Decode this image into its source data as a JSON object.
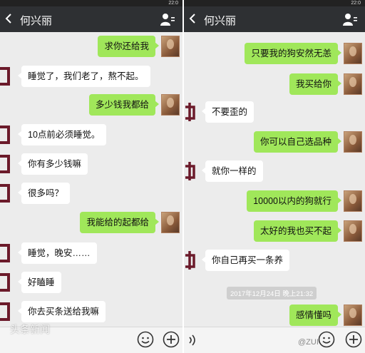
{
  "status_text": "22:0",
  "left": {
    "title": "何兴丽",
    "messages": [
      {
        "side": "me",
        "text": "求你还给我"
      },
      {
        "side": "them",
        "text": "睡觉了，我们老了，熬不起。"
      },
      {
        "side": "me",
        "text": "多少钱我都给"
      },
      {
        "side": "them",
        "text": "10点前必须睡觉。"
      },
      {
        "side": "them",
        "text": "你有多少钱嘛"
      },
      {
        "side": "them",
        "text": "很多吗？"
      },
      {
        "side": "me",
        "text": "我能给的起都给"
      },
      {
        "side": "them",
        "text": "睡觉，晚安……"
      },
      {
        "side": "them",
        "text": "好瞌睡"
      },
      {
        "side": "them",
        "text": "你去买条送给我嘛"
      }
    ],
    "watermark": "头条新闻"
  },
  "right": {
    "title": "何兴丽",
    "messages": [
      {
        "side": "me",
        "text": "只要我的狗安然无恙"
      },
      {
        "side": "me",
        "text": "我买给你"
      },
      {
        "side": "them",
        "text": "不要歪的"
      },
      {
        "side": "me",
        "text": "你可以自己选品种"
      },
      {
        "side": "them",
        "text": "就你一样的"
      },
      {
        "side": "me",
        "text": "10000以内的狗就行"
      },
      {
        "side": "me",
        "text": "太好的我也买不起"
      },
      {
        "side": "them",
        "text": "你自己再买一条养"
      },
      {
        "side": "me",
        "text": "感情懂吗"
      }
    ],
    "timestamp": "2017年12月24日 晚上21:32",
    "watermark": "@ZUI"
  },
  "colors": {
    "me_bubble": "#a0e75a",
    "them_bubble": "#ffffff",
    "titlebar": "#2e3033",
    "background": "#ececec"
  }
}
